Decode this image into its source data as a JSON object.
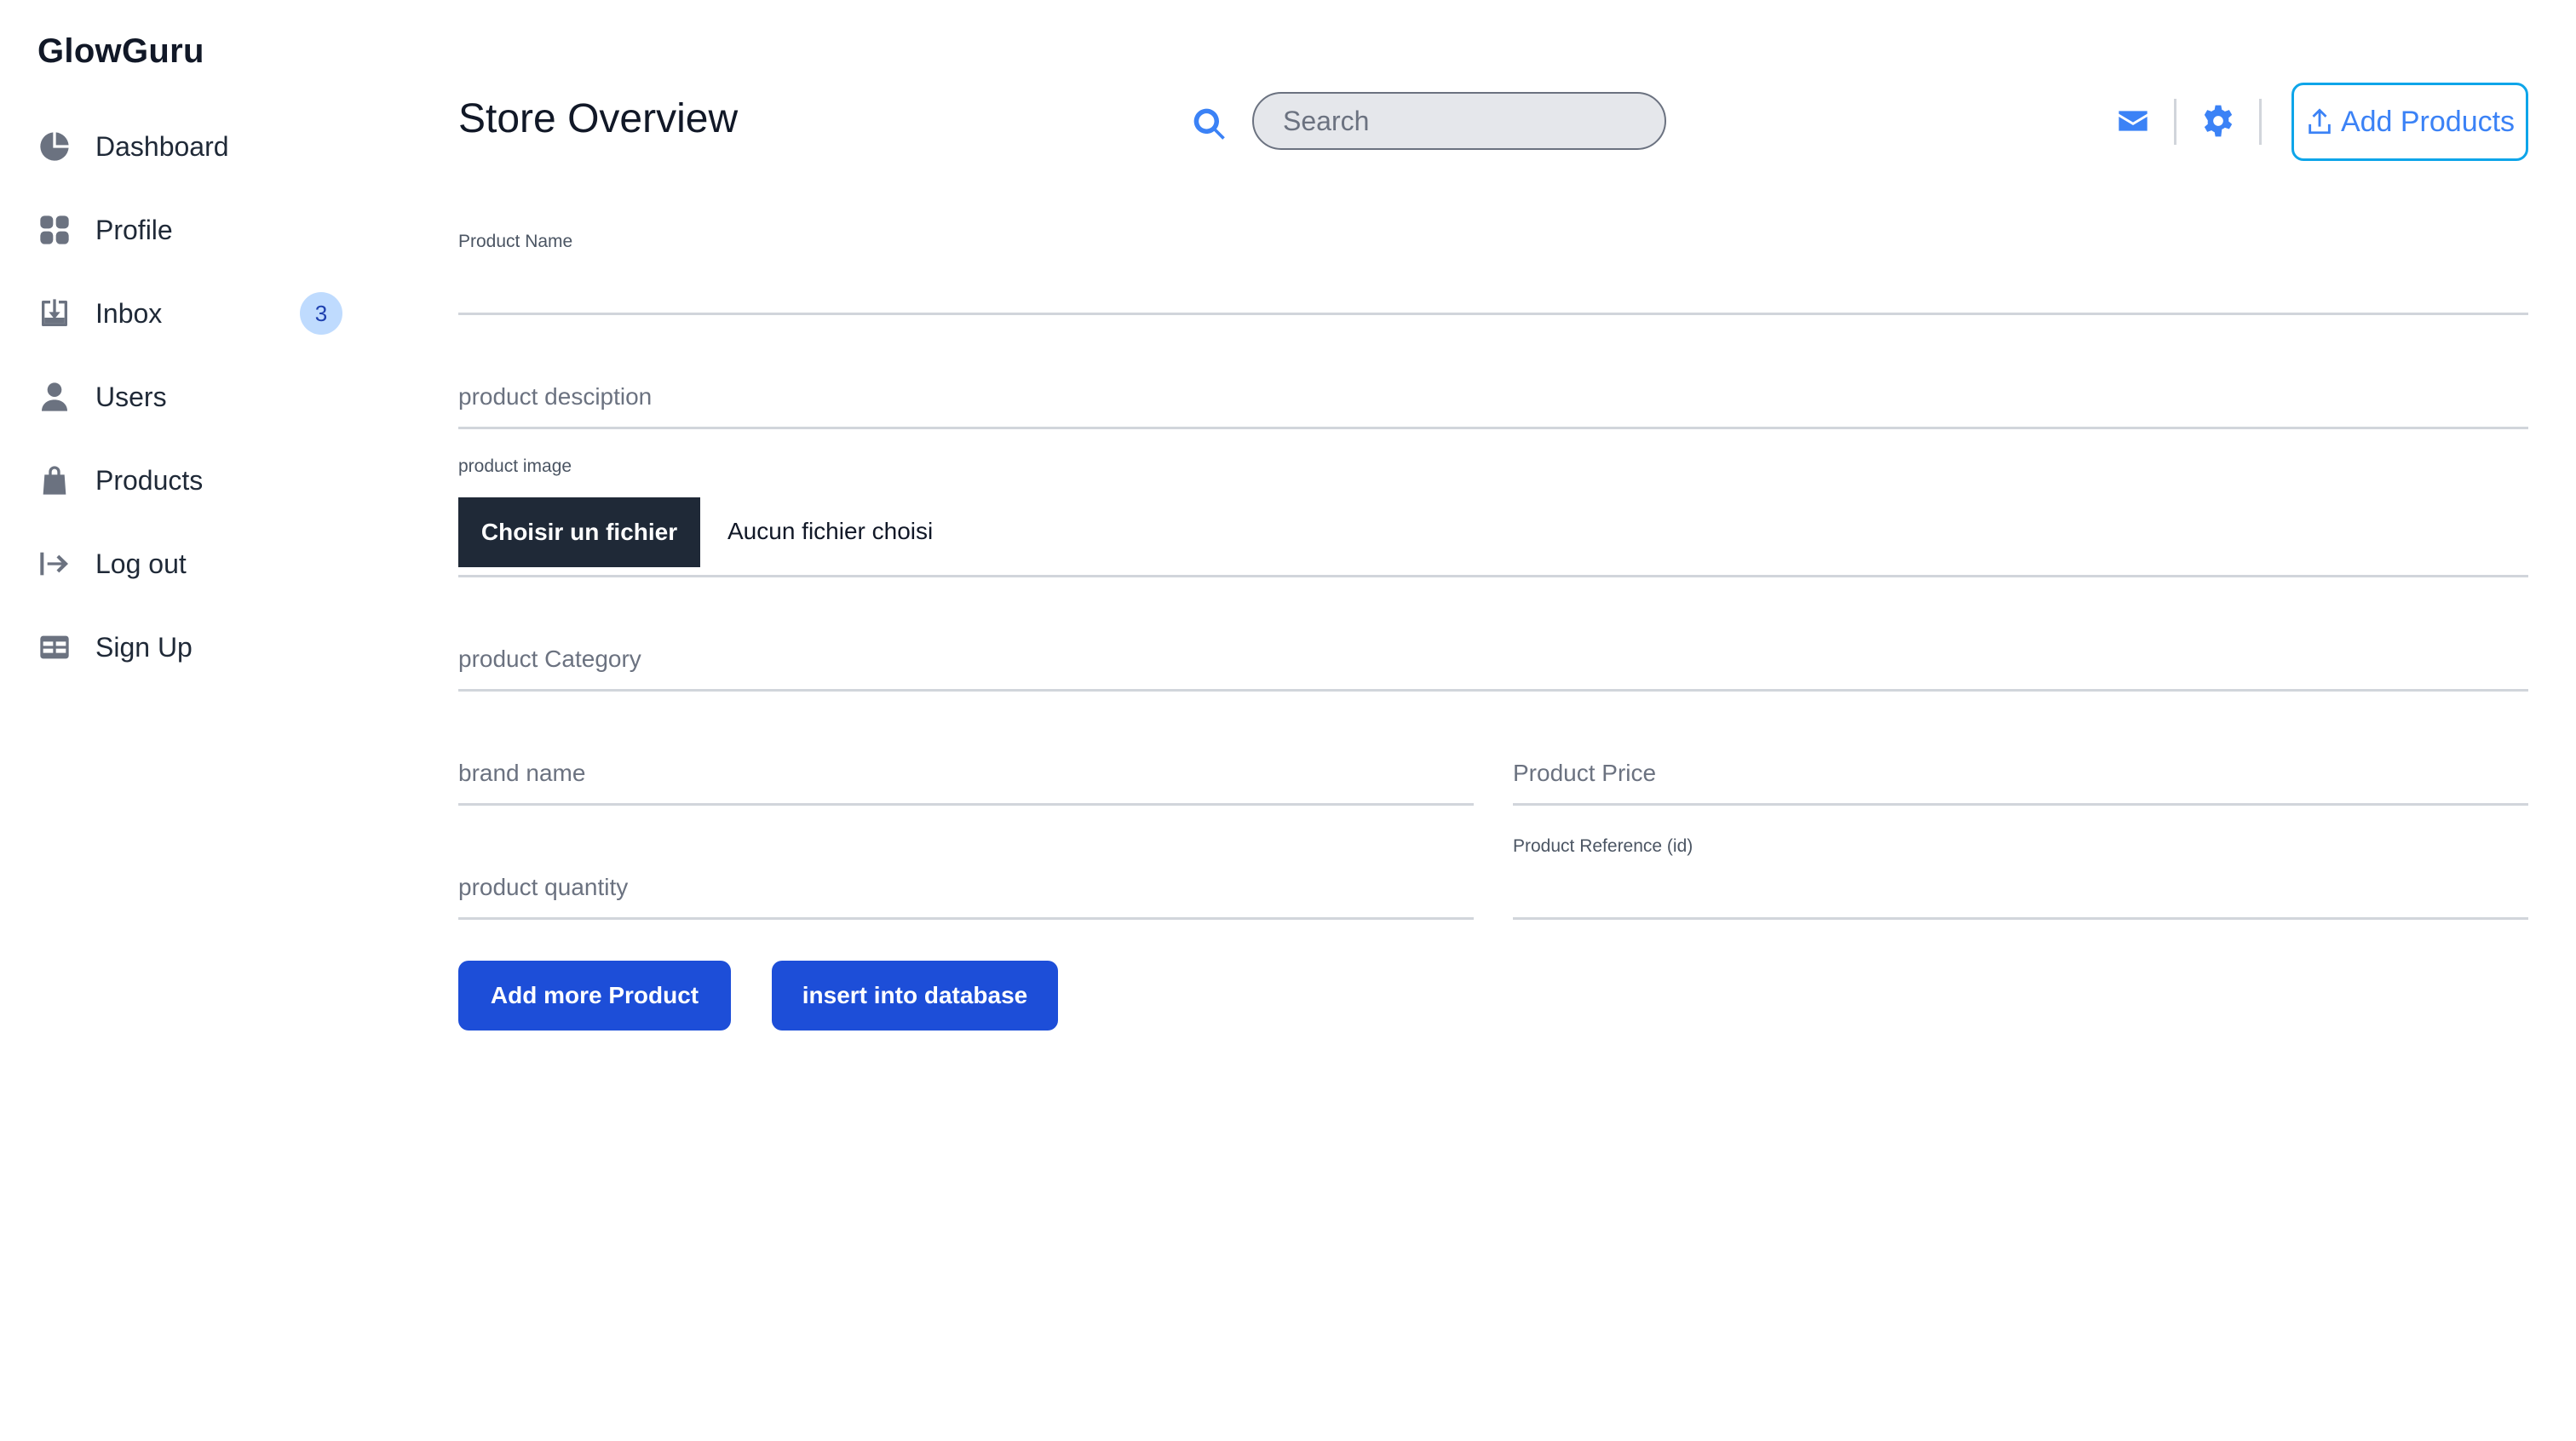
{
  "sidebar": {
    "brand": "GlowGuru",
    "items": [
      {
        "label": "Dashboard",
        "icon": "pie-chart-icon"
      },
      {
        "label": "Profile",
        "icon": "grid-icon"
      },
      {
        "label": "Inbox",
        "icon": "inbox-download-icon",
        "badge": "3"
      },
      {
        "label": "Users",
        "icon": "user-icon"
      },
      {
        "label": "Products",
        "icon": "shopping-bag-icon"
      },
      {
        "label": "Log out",
        "icon": "logout-arrow-icon"
      },
      {
        "label": "Sign Up",
        "icon": "id-card-icon"
      }
    ]
  },
  "header": {
    "title": "Store Overview",
    "search_placeholder": "Search",
    "add_products_label": "Add Products"
  },
  "form": {
    "product_name_label": "Product Name",
    "product_description_placeholder": "product desciption",
    "product_image_label": "product image",
    "file_button_label": "Choisir un fichier",
    "file_status": "Aucun fichier choisi",
    "product_category_placeholder": "product Category",
    "brand_name_placeholder": "brand name",
    "product_price_placeholder": "Product Price",
    "product_quantity_placeholder": "product quantity",
    "product_reference_label": "Product Reference (id)",
    "add_more_label": "Add more Product",
    "insert_label": "insert into database"
  },
  "colors": {
    "accent": "#3b82f6",
    "primary_button": "#1d4ed8",
    "file_button": "#1f2937",
    "badge_bg": "#bfdbfe"
  }
}
